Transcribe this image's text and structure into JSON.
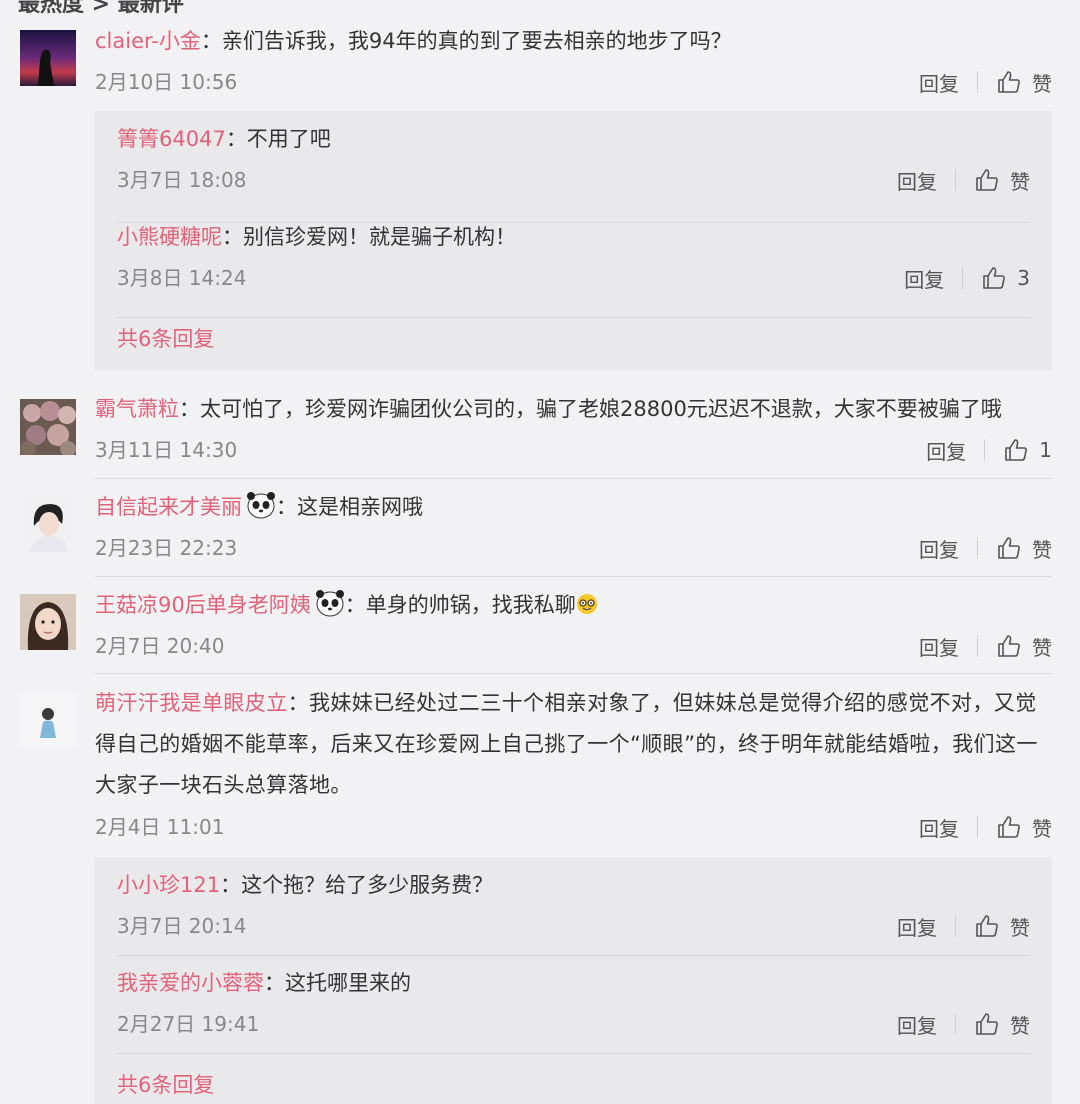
{
  "header": {
    "cropped_title": "最热度 > 最新评"
  },
  "like_icon": "thumbs-up-icon",
  "comments": [
    {
      "user": "claier-小金",
      "text": "：亲们告诉我，我94年的真的到了要去相亲的地步了吗？",
      "time": "2月10日 10:56",
      "reply_label": "回复",
      "like_label": "赞",
      "replies": [
        {
          "user": "箐箐64047",
          "text": "：不用了吧",
          "time": "3月7日 18:08",
          "reply_label": "回复",
          "like_label": "赞"
        },
        {
          "user": "小熊硬糖呢",
          "text": "：别信珍爱网！就是骗子机构！",
          "time": "3月8日 14:24",
          "reply_label": "回复",
          "like_label": "3"
        }
      ],
      "total_label": "共6条回复"
    },
    {
      "user": "霸气萧粒",
      "text": "：太可怕了，珍爱网诈骗团伙公司的，骗了老娘28800元迟迟不退款，大家不要被骗了哦",
      "time": "3月11日 14:30",
      "reply_label": "回复",
      "like_label": "1"
    },
    {
      "user": "自信起来才美丽",
      "text": "：这是相亲网哦",
      "time": "2月23日 22:23",
      "reply_label": "回复",
      "like_label": "赞"
    },
    {
      "user": "王菇凉90后单身老阿姨",
      "text": "：单身的帅锅，找我私聊",
      "time": "2月7日 20:40",
      "reply_label": "回复",
      "like_label": "赞"
    },
    {
      "user": "萌汗汗我是单眼皮立",
      "text": "：我妹妹已经处过二三十个相亲对象了，但妹妹总是觉得介绍的感觉不对，又觉得自己的婚姻不能草率，后来又在珍爱网上自己挑了一个“顺眼”的，终于明年就能结婚啦，我们这一大家子一块石头总算落地。",
      "time": "2月4日 11:01",
      "reply_label": "回复",
      "like_label": "赞",
      "replies": [
        {
          "user": "小小珍121",
          "text": "：这个拖？给了多少服务费？",
          "time": "3月7日 20:14",
          "reply_label": "回复",
          "like_label": "赞"
        },
        {
          "user": "我亲爱的小蓉蓉",
          "text": "：这托哪里来的",
          "time": "2月27日 19:41",
          "reply_label": "回复",
          "like_label": "赞"
        }
      ],
      "total_label": "共6条回复"
    }
  ]
}
